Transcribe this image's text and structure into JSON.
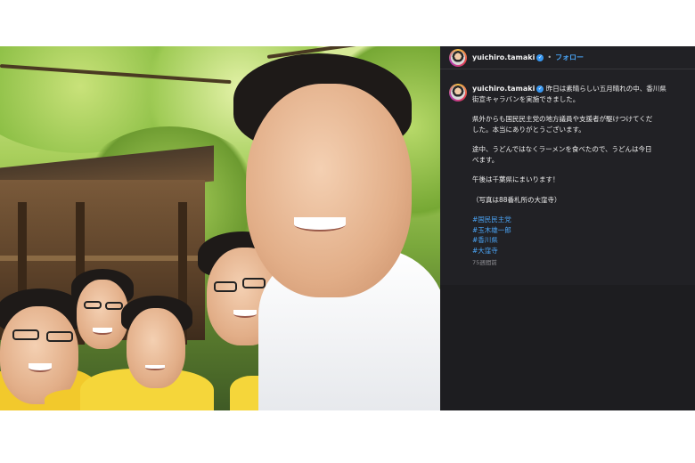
{
  "post": {
    "username": "yuichiro.tamaki",
    "follow_label": "フォロー",
    "separator": "•",
    "caption": {
      "line1a": "昨日は素晴らしい五月晴れの中、香川県",
      "line1b": "街宣キャラバンを実施できました。",
      "para2a": "県外からも国民民主党の地方議員や支援者が駆けつけてくだ",
      "para2b": "した。本当にありがとうございます。",
      "para3a": "途中、うどんではなくラーメンを食べたので、うどんは今日",
      "para3b": "べます。",
      "para4": "午後は千葉県にまいります！",
      "para5": "（写真は88番札所の大窪寺）"
    },
    "hashtags": [
      "#国民民主党",
      "#玉木雄一郎",
      "#香川県",
      "#大窪寺"
    ],
    "timestamp": "75週間前"
  },
  "colors": {
    "panel_bg": "#212125",
    "link": "#4aa4f5",
    "verified": "#3897f0"
  }
}
